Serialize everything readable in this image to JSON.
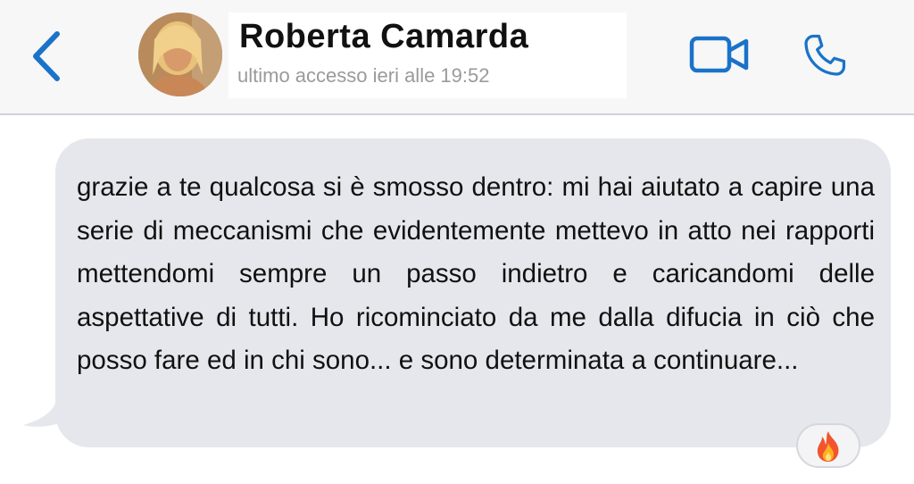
{
  "header": {
    "contact_name": "Roberta Camarda",
    "last_seen": "ultimo accesso ieri alle 19:52",
    "back_icon": "chevron-left-icon",
    "video_icon": "video-camera-icon",
    "call_icon": "phone-icon",
    "accent_color": "#1a73c8"
  },
  "message": {
    "text": "grazie a te qualcosa si è smosso dentro: mi hai aiutato a capire una serie di meccanismi che evidentemente mettevo in atto nei rapporti mettendomi sempre un passo indietro e caricandomi delle aspettative di tutti. Ho ricominciato da me dalla difucia in ciò che posso fare ed in chi sono... e sono determinata a continuare...",
    "bubble_color": "#e6e7ec",
    "reaction_icon": "fire-icon"
  }
}
